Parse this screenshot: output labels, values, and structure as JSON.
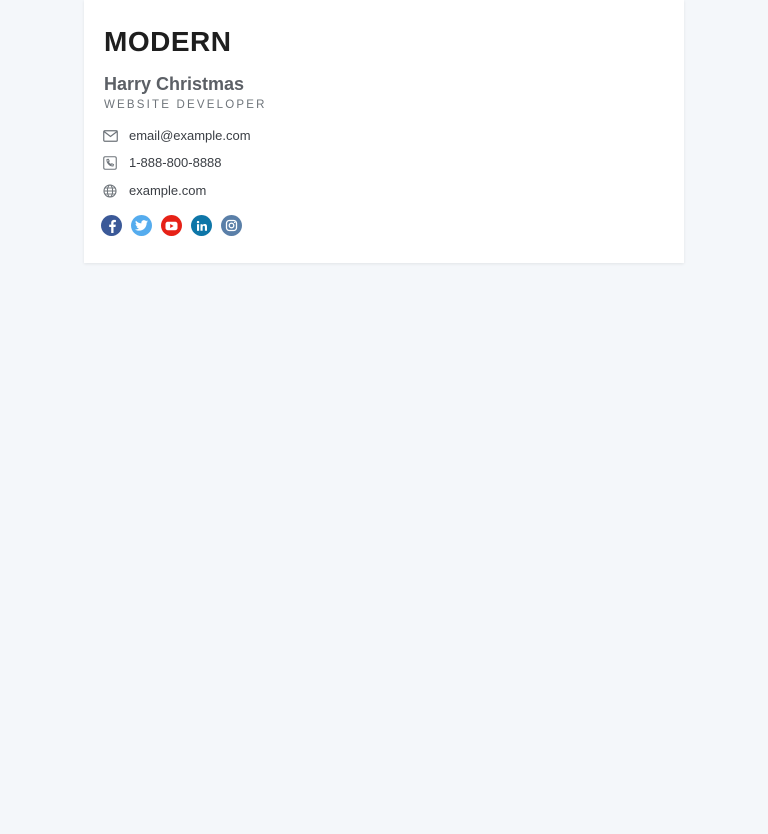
{
  "logo": "MODERN",
  "person": {
    "name": "Harry Christmas",
    "role": "WEBSITE DEVELOPER"
  },
  "contacts": {
    "email": "email@example.com",
    "phone": "1-888-800-8888",
    "website": "example.com"
  },
  "icons": {
    "email": "envelope-icon",
    "phone": "phone-icon",
    "website": "globe-icon"
  },
  "social": [
    {
      "name": "facebook",
      "icon": "facebook-icon",
      "color": "#3b5998"
    },
    {
      "name": "twitter",
      "icon": "twitter-icon",
      "color": "#55acee"
    },
    {
      "name": "youtube",
      "icon": "youtube-icon",
      "color": "#e62117"
    },
    {
      "name": "linkedin",
      "icon": "linkedin-icon",
      "color": "#0e76a8"
    },
    {
      "name": "instagram",
      "icon": "instagram-icon",
      "color": "#5a7fa8"
    }
  ],
  "colors": {
    "background": "#f4f7fa",
    "card": "#ffffff",
    "name": "#5c6066",
    "text": "#3a3e44"
  }
}
